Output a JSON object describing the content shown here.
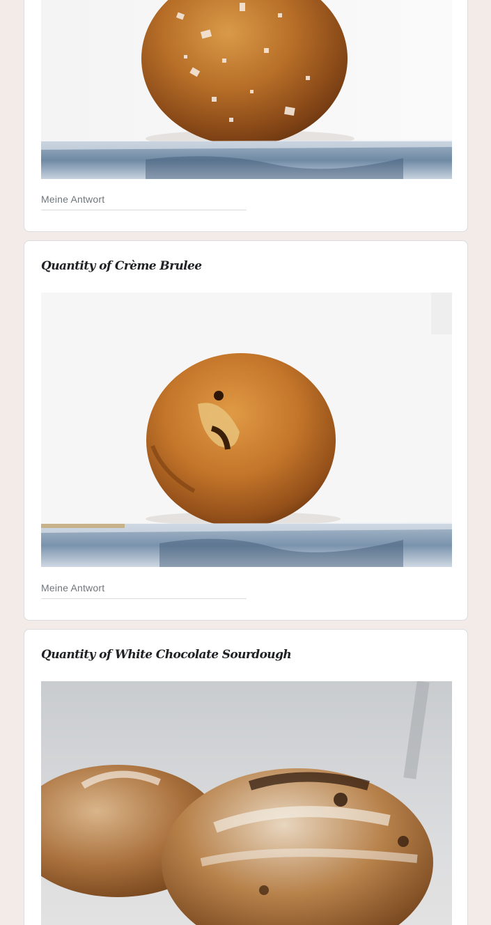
{
  "questions": [
    {
      "title": "",
      "image_name": "salted-pretzel-bun-photo",
      "answer_placeholder": "Meine Antwort"
    },
    {
      "title": "Quantity of Crème Brulee",
      "image_name": "creme-brulee-bun-photo",
      "answer_placeholder": "Meine Antwort"
    },
    {
      "title": "Quantity of White Chocolate Sourdough",
      "image_name": "white-chocolate-sourdough-photo"
    }
  ],
  "colors": {
    "page_background": "#f2ebe7",
    "card_background": "#ffffff",
    "card_border": "#dadce0",
    "title_text": "#202124",
    "placeholder_text": "#70757a"
  }
}
